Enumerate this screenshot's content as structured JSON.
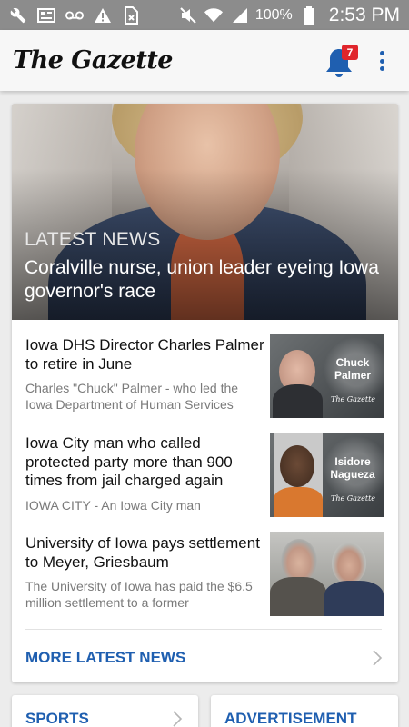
{
  "status_bar": {
    "battery_percent": "100%",
    "time": "2:53 PM",
    "icons": [
      "wrench-icon",
      "news-icon",
      "voicemail-icon",
      "warning-icon",
      "sim-icon",
      "mute-icon",
      "wifi-icon",
      "signal-icon",
      "battery-icon"
    ]
  },
  "app_bar": {
    "logo": "The Gazette",
    "notification_count": "7"
  },
  "hero": {
    "label": "LATEST NEWS",
    "title": "Coralville nurse, union leader eyeing Iowa governor's race"
  },
  "stories": [
    {
      "title": "Iowa DHS Director Charles Palmer to retire in June",
      "summary": "Charles \"Chuck\" Palmer - who led the Iowa Department of Human Services",
      "thumb_name": "Chuck Palmer",
      "thumb_brand": "The Gazette"
    },
    {
      "title": "Iowa City man who called protected party more than 900 times from jail charged again",
      "summary": "IOWA CITY - An Iowa City man",
      "thumb_name": "Isidore Nagueza",
      "thumb_brand": "The Gazette"
    },
    {
      "title": "University of Iowa pays settlement to Meyer, Griesbaum",
      "summary": "The University of Iowa has paid the $6.5 million settlement to a former"
    }
  ],
  "more_link": "MORE LATEST NEWS",
  "bottom_cards": {
    "sports": "SPORTS",
    "advertisement": "ADVERTISEMENT"
  },
  "colors": {
    "accent": "#1f5fb0",
    "badge": "#e0252c",
    "status_bar": "#8c8c8c"
  }
}
